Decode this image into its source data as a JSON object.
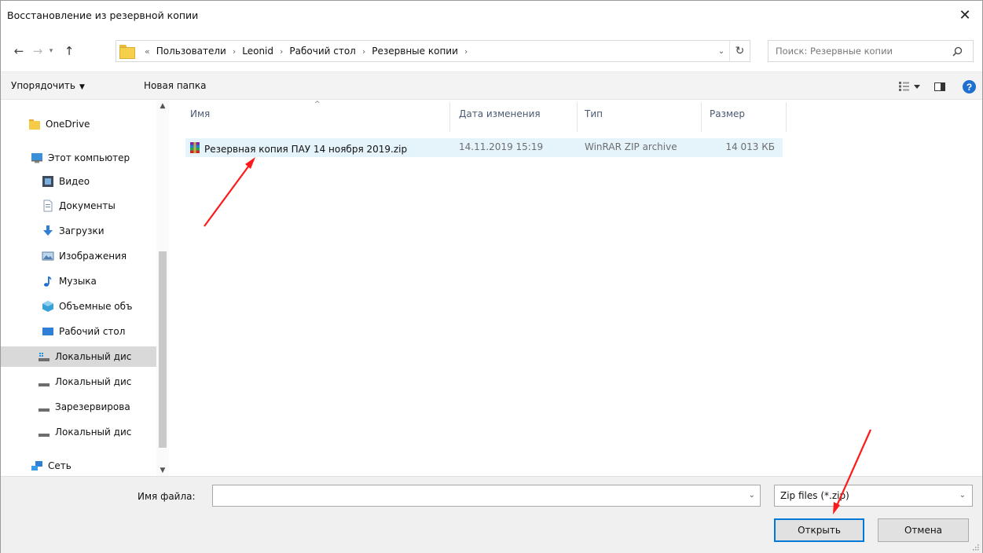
{
  "window": {
    "title": "Восстановление из резервной копии",
    "close_glyph": "✕"
  },
  "nav": {
    "back_glyph": "←",
    "forward_glyph": "→",
    "recent_glyph": "▾",
    "up_glyph": "↑"
  },
  "address": {
    "overflow": "«",
    "crumbs": [
      "Пользователи",
      "Leonid",
      "Рабочий стол",
      "Резервные копии"
    ],
    "separator": "›",
    "dropdown_glyph": "⌄",
    "refresh_glyph": "↻"
  },
  "search": {
    "placeholder": "Поиск: Резервные копии"
  },
  "toolbar": {
    "organize_label": "Упорядочить",
    "organize_caret": "▼",
    "new_folder_label": "Новая папка"
  },
  "navpane": {
    "scroll_up": "▲",
    "scroll_down": "▼",
    "items": [
      {
        "label": "OneDrive",
        "icon": "folder-icon"
      },
      {
        "label": "Этот компьютер",
        "icon": "computer-icon"
      },
      {
        "label": "Видео",
        "icon": "video-icon"
      },
      {
        "label": "Документы",
        "icon": "documents-icon"
      },
      {
        "label": "Загрузки",
        "icon": "downloads-icon"
      },
      {
        "label": "Изображения",
        "icon": "images-icon"
      },
      {
        "label": "Музыка",
        "icon": "music-icon"
      },
      {
        "label": "Объемные объ",
        "icon": "3d-objects-icon"
      },
      {
        "label": "Рабочий стол",
        "icon": "desktop-icon"
      },
      {
        "label": "Локальный дис",
        "icon": "system-drive-icon"
      },
      {
        "label": "Локальный дис",
        "icon": "drive-icon"
      },
      {
        "label": "Зарезервирова",
        "icon": "drive-icon"
      },
      {
        "label": "Локальный дис",
        "icon": "drive-icon"
      },
      {
        "label": "Сеть",
        "icon": "network-icon"
      }
    ]
  },
  "filelist": {
    "sort_glyph": "^",
    "columns": [
      "Имя",
      "Дата изменения",
      "Тип",
      "Размер"
    ],
    "rows": [
      {
        "name": "Резервная копия ПАУ 14 ноября 2019.zip",
        "date": "14.11.2019 15:19",
        "type": "WinRAR ZIP archive",
        "size": "14 013 КБ",
        "icon": "winrar-archive-icon"
      }
    ]
  },
  "bottom": {
    "filename_label": "Имя файла:",
    "filename_value": "",
    "filename_drop": "⌄",
    "filetype_value": "Zip files (*.zip)",
    "filetype_caret": "⌄",
    "open_label": "Открыть",
    "cancel_label": "Отмена"
  },
  "colors": {
    "selection": "#e5f3fb",
    "accent": "#0078d7",
    "annotation_arrow": "#ff1a1a"
  }
}
